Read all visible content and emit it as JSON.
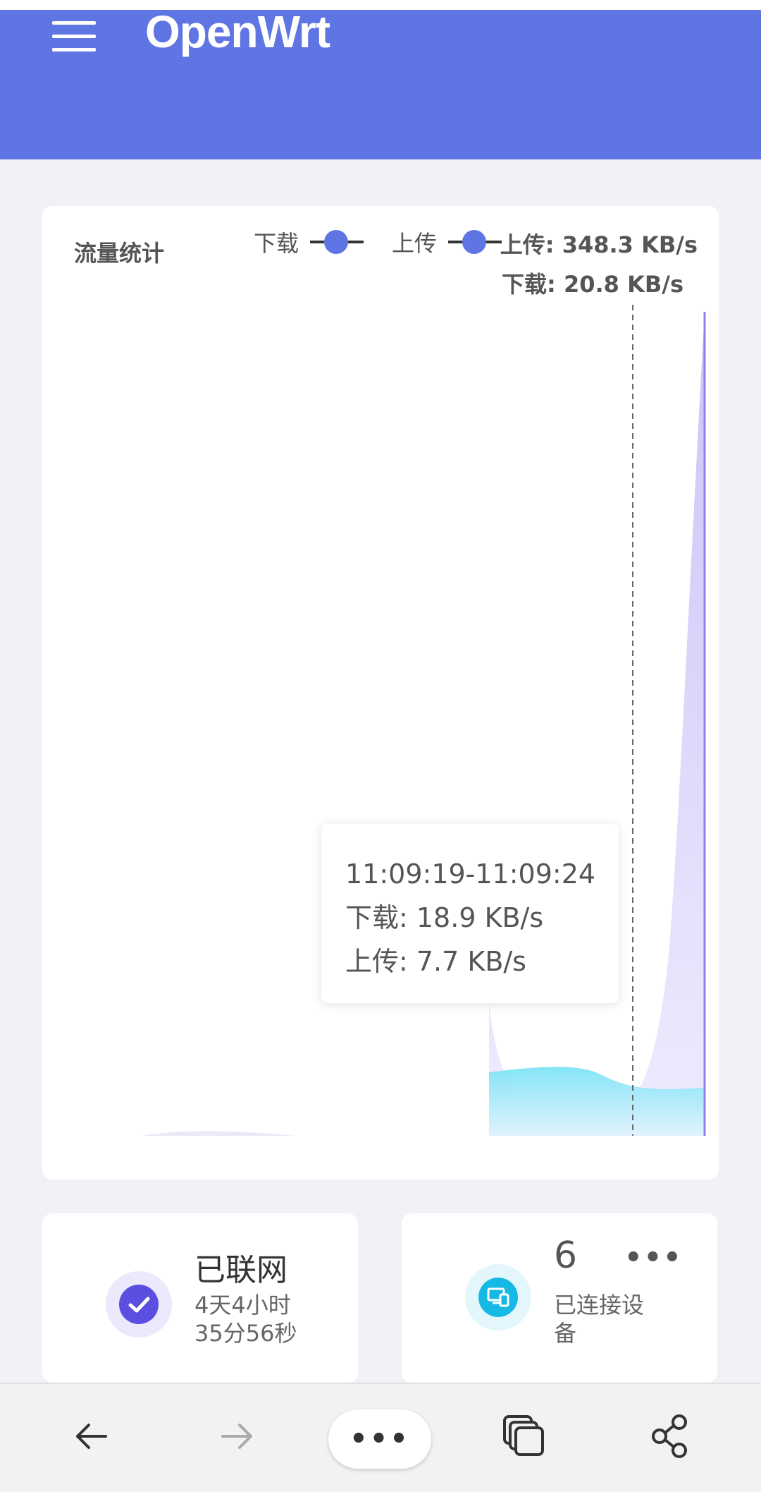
{
  "header": {
    "logo_text": "OpenWrt",
    "background_color": "#5f75e3"
  },
  "traffic": {
    "title": "流量统计",
    "legend": [
      {
        "label": "下载",
        "color": "#5f75e3"
      },
      {
        "label": "上传",
        "color": "#5f75e3"
      }
    ],
    "upload_rate": "上传: 348.3 KB/s",
    "download_rate": "下载: 20.8 KB/s",
    "tooltip": {
      "time": "11:09:19-11:09:24",
      "download": "下载: 18.9 KB/s",
      "upload": "上传: 7.7 KB/s"
    }
  },
  "status": {
    "network": {
      "title": "已联网",
      "uptime_line1": "4天4小时",
      "uptime_line2": "35分56秒",
      "icon": "check-icon",
      "color": "#5a4fe0"
    },
    "devices": {
      "count": "6",
      "label_line1": "已连接设",
      "label_line2": "备",
      "more": "•••",
      "icon": "devices-icon",
      "color": "#16b9e6"
    }
  },
  "browser_bar": {
    "back_icon": "arrow-left-icon",
    "forward_icon": "arrow-right-icon",
    "menu_label": "•••",
    "tabs_icon": "tabs-icon",
    "share_icon": "share-icon"
  }
}
